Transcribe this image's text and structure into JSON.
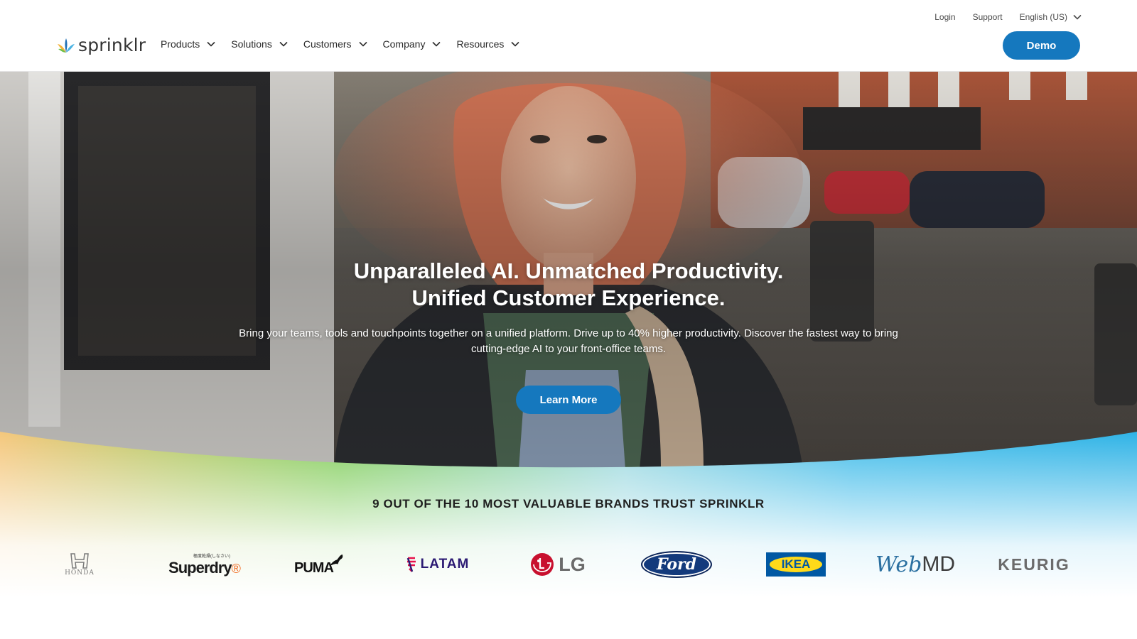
{
  "header": {
    "logo_text": "sprinklr",
    "util": {
      "login": "Login",
      "support": "Support",
      "language": "English (US)"
    },
    "nav": [
      "Products",
      "Solutions",
      "Customers",
      "Company",
      "Resources"
    ],
    "demo_label": "Demo"
  },
  "hero": {
    "title_line1": "Unparalleled AI. Unmatched Productivity.",
    "title_line2": "Unified Customer Experience.",
    "subtitle": "Bring your teams, tools and touchpoints together on a unified platform. Drive up to 40% higher productivity. Discover the fastest way to bring cutting-edge AI to your front-office teams.",
    "cta_label": "Learn More"
  },
  "brands": {
    "heading": "9 OUT OF THE 10 MOST VALUABLE BRANDS TRUST SPRINKLR",
    "logos": [
      {
        "name": "honda-logo",
        "text": "HONDA"
      },
      {
        "name": "superdry-logo",
        "text": "Superdry",
        "suffix": "®",
        "tagline": "極度乾燥(しなさい)"
      },
      {
        "name": "puma-logo",
        "text": "PUMA"
      },
      {
        "name": "latam-logo",
        "text": "LATAM"
      },
      {
        "name": "lg-logo",
        "text": "LG"
      },
      {
        "name": "ford-logo",
        "text": "Ford"
      },
      {
        "name": "ikea-logo",
        "text": "IKEA"
      },
      {
        "name": "webmd-logo",
        "text_a": "Web",
        "text_b": "MD"
      },
      {
        "name": "keurig-logo",
        "text": "KEURIG"
      }
    ]
  },
  "colors": {
    "primary_button": "#1578be",
    "wave_left": "#f4c77c",
    "wave_mid": "#7fcd5a",
    "wave_right": "#2fb3e6"
  }
}
